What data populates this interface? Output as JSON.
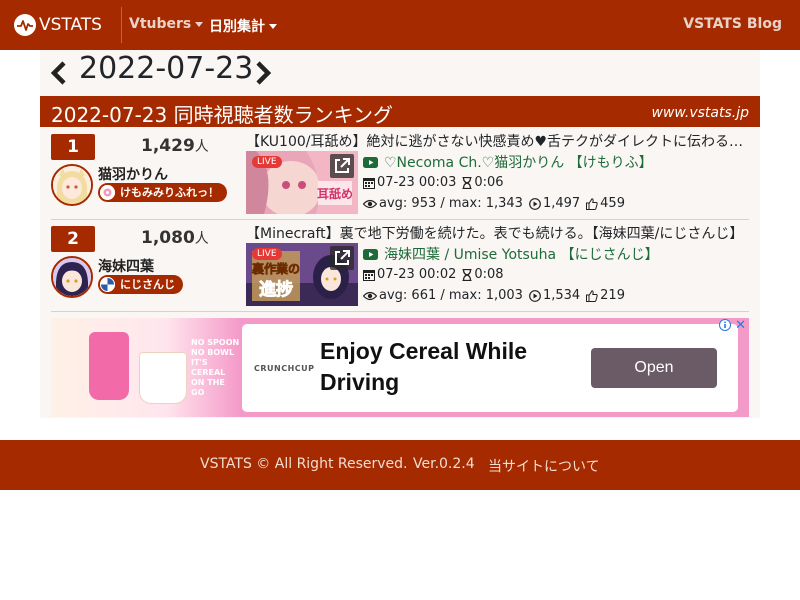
{
  "navbar": {
    "brand": "VSTATS",
    "vtubers_label": "Vtubers",
    "daily_label": "日別集計",
    "blog_label": "VSTATS Blog"
  },
  "date": {
    "current": "2022-07-23"
  },
  "ranking": {
    "title": "2022-07-23 同時視聴者数ランキング",
    "site": "www.vstats.jp",
    "rows": [
      {
        "rank": "1",
        "viewers": "1,429",
        "unit": "人",
        "vtuber_name": "猫羽かりん",
        "agency": "けもみみりふれっ！",
        "video_title": "【KU100/耳舐め】絶対に逃がさない快感責め♥舌テクがダイレクトに伝わる…",
        "live_tag": "LIVE",
        "channel": "♡Necoma Ch.♡猫羽かりん 【けもりふ】",
        "start": "07-23 00:03",
        "duration": "0:06",
        "stats": "avg: 953 / max: 1,343",
        "views": "1,497",
        "likes": "459"
      },
      {
        "rank": "2",
        "viewers": "1,080",
        "unit": "人",
        "vtuber_name": "海妹四葉",
        "agency": "にじさんじ",
        "video_title": "【Minecraft】裏で地下労働を続けた。表でも続ける。【海妹四葉/にじさんじ】",
        "live_tag": "LIVE",
        "channel": "海妹四葉 / Umise Yotsuha 【にじさんじ】",
        "start": "07-23 00:02",
        "duration": "0:08",
        "stats": "avg: 661 / max: 1,003",
        "views": "1,534",
        "likes": "219"
      }
    ]
  },
  "ad": {
    "slogan": "NO SPOON NO BOWL IT'S CEREAL ON THE GO",
    "brand": "CRUNCHCUP",
    "headline": "Enjoy Cereal While Driving",
    "button": "Open",
    "close": "✕"
  },
  "footer": {
    "copyright": "VSTATS © All Right Reserved.",
    "version": "Ver.0.2.4",
    "about": "当サイトについて"
  },
  "colors": {
    "primary": "#a52a00",
    "channel_link": "#1e6b3a",
    "ad_pink": "#f49ac8"
  }
}
